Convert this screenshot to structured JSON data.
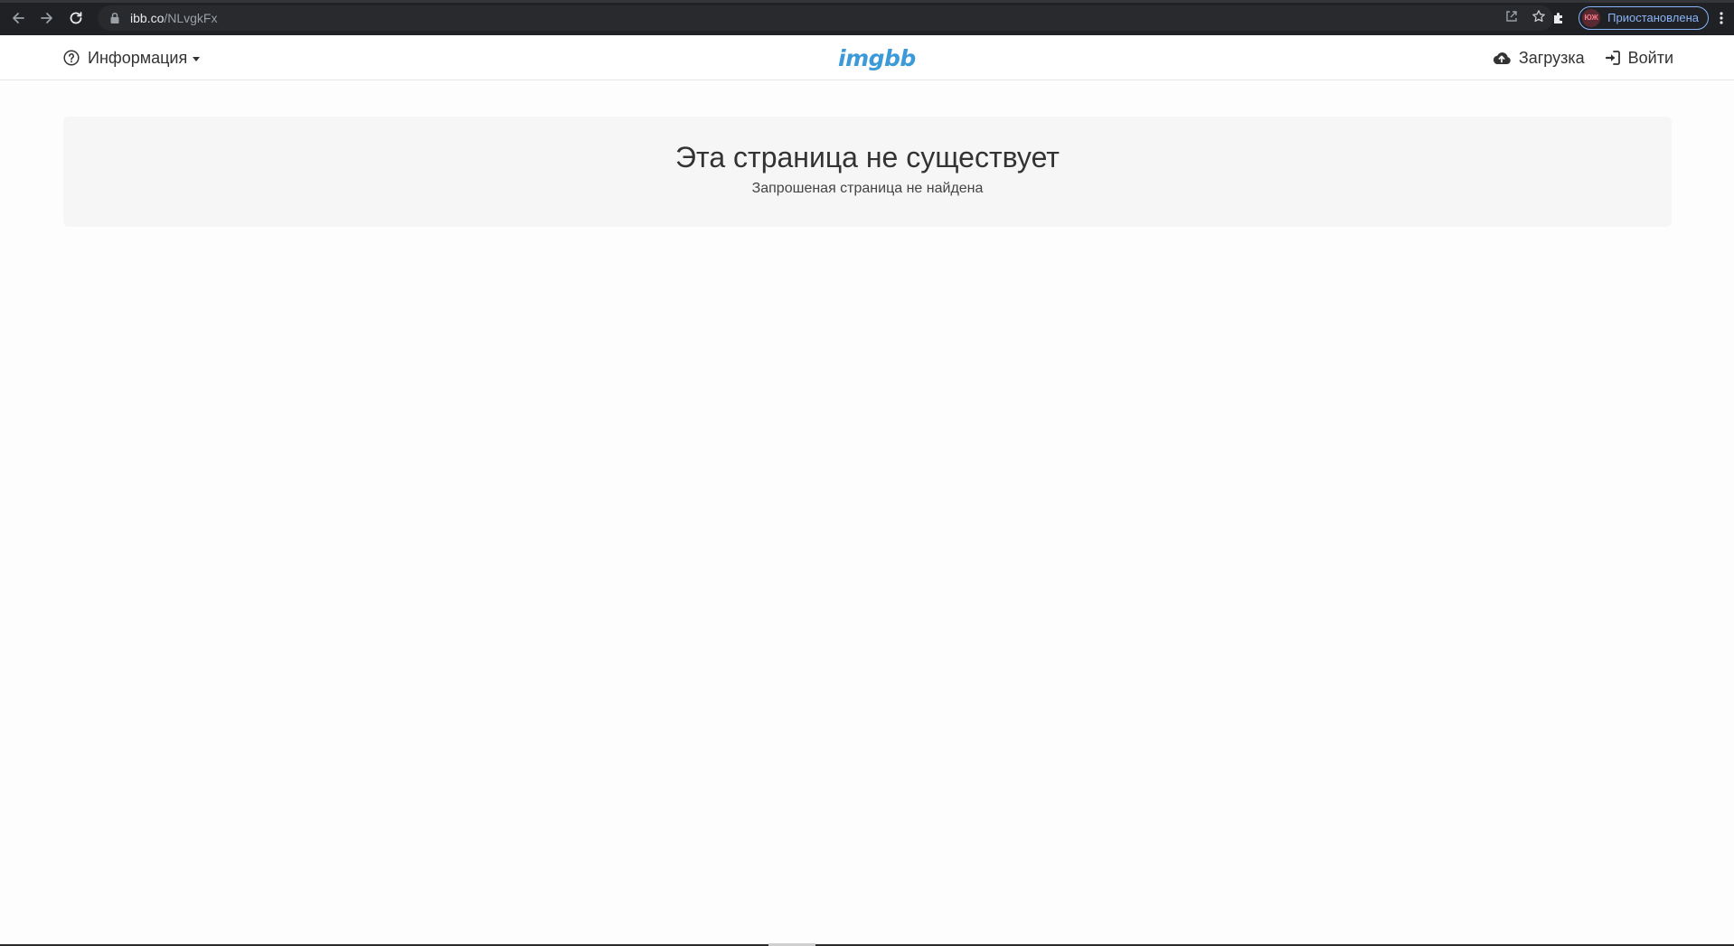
{
  "browser": {
    "url_host": "ibb.co",
    "url_path": "/NLvgkFx",
    "profile_label": "Приостановлена",
    "profile_avatar_text": "ЮЖ",
    "accent_color": "#8ab4f8"
  },
  "header": {
    "info_label": "Информация",
    "logo_text": "imgbb",
    "upload_label": "Загрузка",
    "login_label": "Войти",
    "logo_color": "#3c9ad8"
  },
  "notice": {
    "title": "Эта страница не существует",
    "subtitle": "Запрошеная страница не найдена"
  },
  "icons": [
    "back-icon",
    "forward-icon",
    "reload-icon",
    "lock-icon",
    "share-icon",
    "star-icon",
    "extensions-icon",
    "menu-icon",
    "help-circle-icon",
    "cloud-upload-icon",
    "sign-in-icon"
  ]
}
